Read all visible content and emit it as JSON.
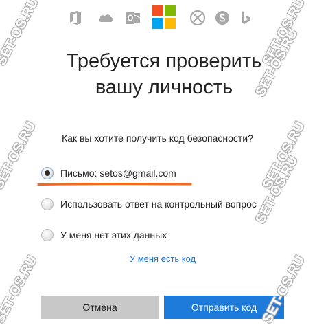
{
  "services": [
    {
      "name": "office-icon"
    },
    {
      "name": "onedrive-icon"
    },
    {
      "name": "outlook-icon"
    },
    {
      "name": "microsoft-logo"
    },
    {
      "name": "xbox-icon"
    },
    {
      "name": "skype-icon"
    },
    {
      "name": "bing-icon"
    }
  ],
  "colors": {
    "ms_red": "#f25022",
    "ms_green": "#7fba00",
    "ms_blue": "#00a4ef",
    "ms_yellow": "#ffb900",
    "accent": "#1e7ad8",
    "link": "#2470c7",
    "annotation_underline": "#f26b1d",
    "icon_gray": "#a8a8a8"
  },
  "page": {
    "title_line1": "Требуется проверить",
    "title_line2": "вашу личность",
    "question": "Как вы хотите получить код безопасности?"
  },
  "options": [
    {
      "label": "Письмо: setos@gmail.com",
      "checked": true
    },
    {
      "label": "Использовать ответ на контрольный вопрос",
      "checked": false
    },
    {
      "label": "У меня нет этих данных",
      "checked": false
    }
  ],
  "link": {
    "label": "У меня есть код"
  },
  "buttons": {
    "cancel": "Отмена",
    "send": "Отправить код"
  },
  "watermark": {
    "text": "SET-OS.RU"
  }
}
